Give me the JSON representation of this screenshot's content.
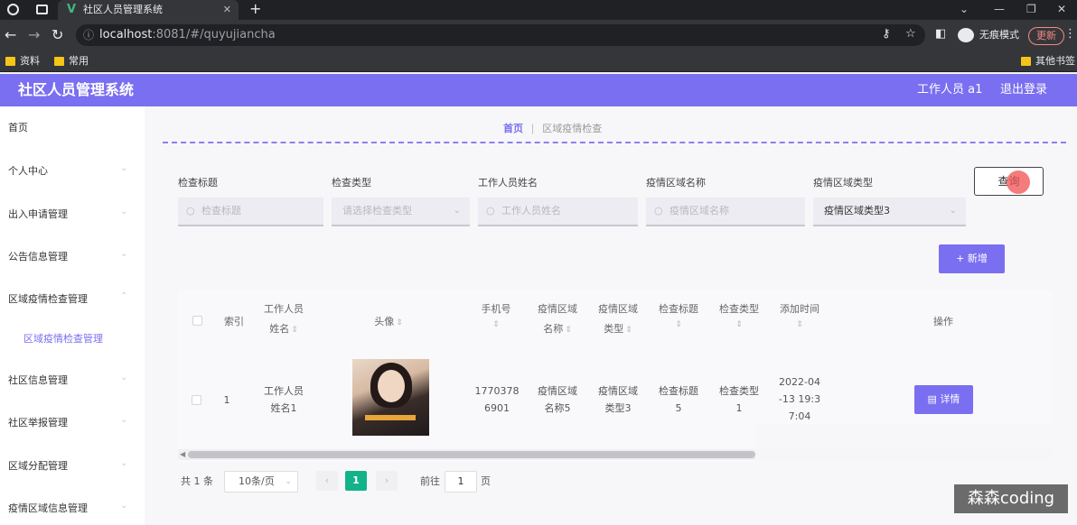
{
  "browser": {
    "tab_title": "社区人员管理系统",
    "tab_close": "✕",
    "new_tab": "+",
    "url_host": "localhost",
    "url_path": ":8081/#/quyujiancha",
    "incognito_label": "无痕模式",
    "update_label": "更新",
    "bookmarks": [
      "资料",
      "常用",
      "其他书签"
    ]
  },
  "header": {
    "title": "社区人员管理系统",
    "user": "工作人员 a1",
    "logout": "退出登录"
  },
  "sidebar": {
    "items": [
      "首页",
      "个人中心",
      "出入申请管理",
      "公告信息管理",
      "区域疫情检查管理",
      "社区信息管理",
      "社区举报管理",
      "区域分配管理",
      "疫情区域信息管理"
    ],
    "sub_item": "区域疫情检查管理"
  },
  "breadcrumb": {
    "home": "首页",
    "current": "区域疫情检查"
  },
  "filters": {
    "labels": [
      "检查标题",
      "检查类型",
      "工作人员姓名",
      "疫情区域名称",
      "疫情区域类型"
    ],
    "placeholders": [
      "检查标题",
      "请选择检查类型",
      "工作人员姓名",
      "疫情区域名称"
    ],
    "area_type_value": "疫情区域类型3",
    "query_button": "查询",
    "add_button": "新增"
  },
  "table": {
    "headers": {
      "index": "索引",
      "worker_line1": "工作人员",
      "worker_line2": "姓名",
      "avatar": "头像",
      "phone": "手机号",
      "area_name_line1": "疫情区域",
      "area_name_line2": "名称",
      "area_type_line1": "疫情区域",
      "area_type_line2": "类型",
      "check_title": "检查标题",
      "check_type": "检查类型",
      "added_time": "添加时间",
      "actions": "操作"
    },
    "row": {
      "index": "1",
      "worker_line1": "工作人员",
      "worker_line2": "姓名1",
      "phone_line1": "1770378",
      "phone_line2": "6901",
      "area_name_line1": "疫情区域",
      "area_name_line2": "名称5",
      "area_type_line1": "疫情区域",
      "area_type_line2": "类型3",
      "check_title_line1": "检查标题",
      "check_title_line2": "5",
      "check_type_line1": "检查类型",
      "check_type_line2": "1",
      "time_line1": "2022-04",
      "time_line2": "-13 19:3",
      "time_line3": "7:04",
      "detail_button": "详情"
    }
  },
  "pagination": {
    "total": "共 1 条",
    "page_size": "10条/页",
    "prev": "‹",
    "current_page": "1",
    "next": "›",
    "goto_prefix": "前往",
    "goto_value": "1",
    "goto_suffix": "页"
  },
  "watermark": "森森coding",
  "colors": {
    "accent": "#7a6ff0",
    "pager_active": "#13b38a"
  }
}
